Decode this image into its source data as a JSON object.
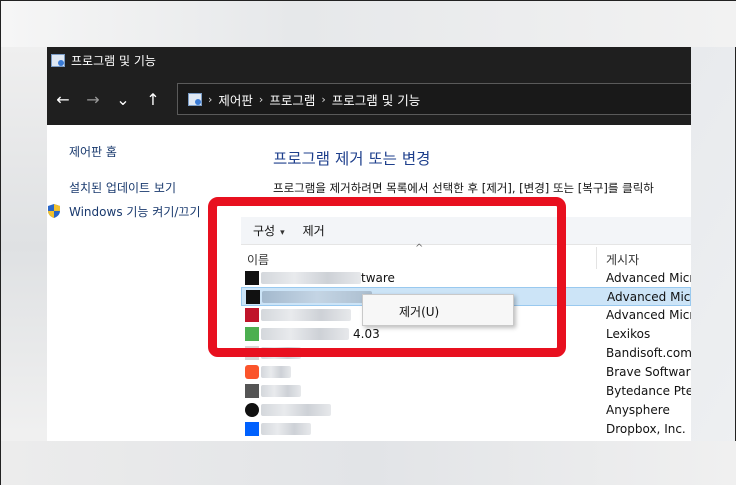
{
  "window": {
    "title": "프로그램 및 기능",
    "breadcrumb": [
      "제어판",
      "프로그램",
      "프로그램 및 기능"
    ]
  },
  "nav": {
    "back": "←",
    "forward": "→",
    "recent": "⌄",
    "up": "↑"
  },
  "sidebar": {
    "home": "제어판 홈",
    "updates": "설치된 업데이트 보기",
    "windows_features": "Windows 기능 켜기/끄기"
  },
  "main": {
    "heading": "프로그램 제거 또는 변경",
    "description": "프로그램을 제거하려면 목록에서 선택한 후 [제거], [변경] 또는 [복구]를 클릭하"
  },
  "toolbar": {
    "organize": "구성",
    "organize_caret": "▾",
    "uninstall": "제거"
  },
  "columns": {
    "name": "이름",
    "publisher": "게시자",
    "sort_indicator": "^"
  },
  "rows": [
    {
      "name_fragment": "tware",
      "publisher": "Advanced Micro",
      "icon": "black-box-icon",
      "icon_color": "#111111"
    },
    {
      "name_fragment": "",
      "publisher": "Advanced Micro",
      "icon": "black-box-icon",
      "icon_color": "#111111",
      "selected": true
    },
    {
      "name_fragment": "",
      "publisher": "Advanced Micro",
      "icon": "red-box-icon",
      "icon_color": "#c0142a"
    },
    {
      "name_fragment": "4.03",
      "publisher": "Lexikos",
      "icon": "green-h-icon",
      "icon_color": "#4caf50"
    },
    {
      "name_fragment": "",
      "publisher": "Bandisoft.com",
      "icon": "app-icon",
      "icon_color": "#d8d8d8"
    },
    {
      "name_fragment": "",
      "publisher": "Brave Software",
      "icon": "lion-icon",
      "icon_color": "#fb542b"
    },
    {
      "name_fragment": "",
      "publisher": "Bytedance Pte. L",
      "icon": "app-icon",
      "icon_color": "#555555"
    },
    {
      "name_fragment": "",
      "publisher": "Anysphere",
      "icon": "cube-icon",
      "icon_color": "#111111"
    },
    {
      "name_fragment": "",
      "publisher": "Dropbox, Inc.",
      "icon": "dropbox-icon",
      "icon_color": "#0061fe"
    }
  ],
  "context_menu": {
    "uninstall": "제거(U)"
  },
  "colors": {
    "highlight": "#e8101f",
    "heading": "#1e3f8c",
    "selection": "#cce4f7"
  }
}
